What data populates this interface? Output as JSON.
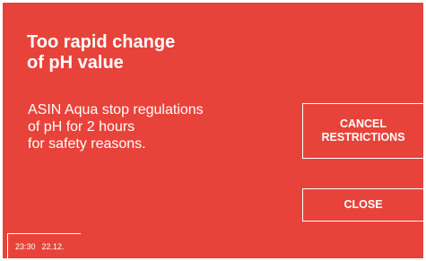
{
  "dialog": {
    "title": "Too rapid change\nof pH value",
    "message": "ASIN Aqua stop regulations\nof pH for 2 hours\nfor safety reasons.",
    "cancel_label": "CANCEL\nRESTRICTIONS",
    "close_label": "CLOSE"
  },
  "status_bar": {
    "time": "23:30",
    "date": "22.12."
  },
  "colors": {
    "background": "#e8433a",
    "foreground": "#ffffff"
  }
}
